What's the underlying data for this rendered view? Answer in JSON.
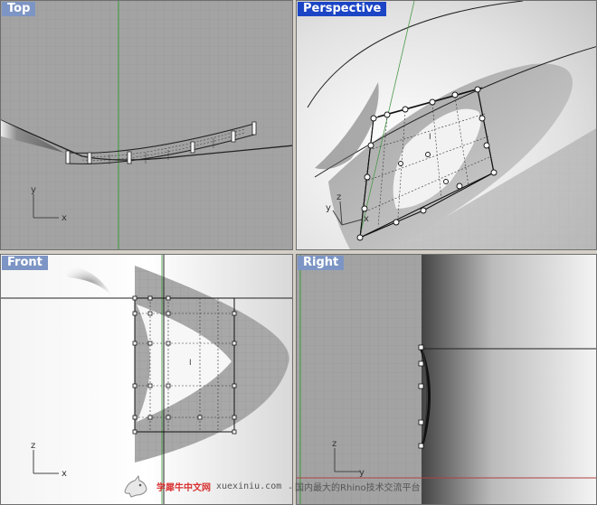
{
  "viewports": {
    "top": {
      "label": "Top",
      "axis_x": "x",
      "axis_y": "y"
    },
    "perspective": {
      "label": "Perspective",
      "axis_x": "x",
      "axis_y": "y",
      "axis_z": "z"
    },
    "front": {
      "label": "Front",
      "axis_x": "x",
      "axis_z": "z"
    },
    "right": {
      "label": "Right",
      "axis_y": "y",
      "axis_z": "z"
    }
  },
  "active_viewport": "perspective",
  "colors": {
    "title_inactive": "#7d95c4",
    "title_active": "#1c45c5",
    "grid_bg": "#a3a3a3",
    "grid_line": "#8d8d8d",
    "axis_x": "#b04040",
    "axis_y": "#3a9a3a"
  },
  "watermark": {
    "brand": "学犀牛中文网",
    "site": "xuexiniu.com",
    "slogan": "- 国内最大的Rhino技术交流平台"
  }
}
